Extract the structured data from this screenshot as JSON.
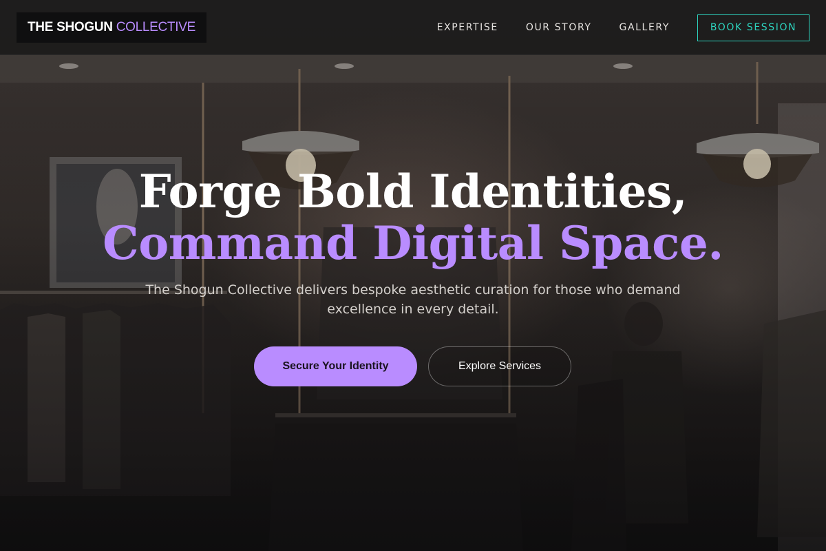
{
  "brand": {
    "name_primary": "THE SHOGUN",
    "name_accent": "COLLECTIVE"
  },
  "nav": {
    "links": [
      {
        "label": "EXPERTISE"
      },
      {
        "label": "OUR STORY"
      },
      {
        "label": "GALLERY"
      }
    ],
    "cta_label": "BOOK SESSION"
  },
  "hero": {
    "headline_line1": "Forge Bold Identities,",
    "headline_line2": "Command Digital Space.",
    "subtitle": "The Shogun Collective delivers bespoke aesthetic curation for those who demand excellence in every detail.",
    "primary_cta": "Secure Your Identity",
    "secondary_cta": "Explore Services",
    "background_image": "clothing-store-interior"
  },
  "colors": {
    "accent_purple": "#b98cff",
    "accent_teal": "#2dd4bf",
    "nav_background": "#1c1b1b",
    "text_white": "#ffffff"
  }
}
